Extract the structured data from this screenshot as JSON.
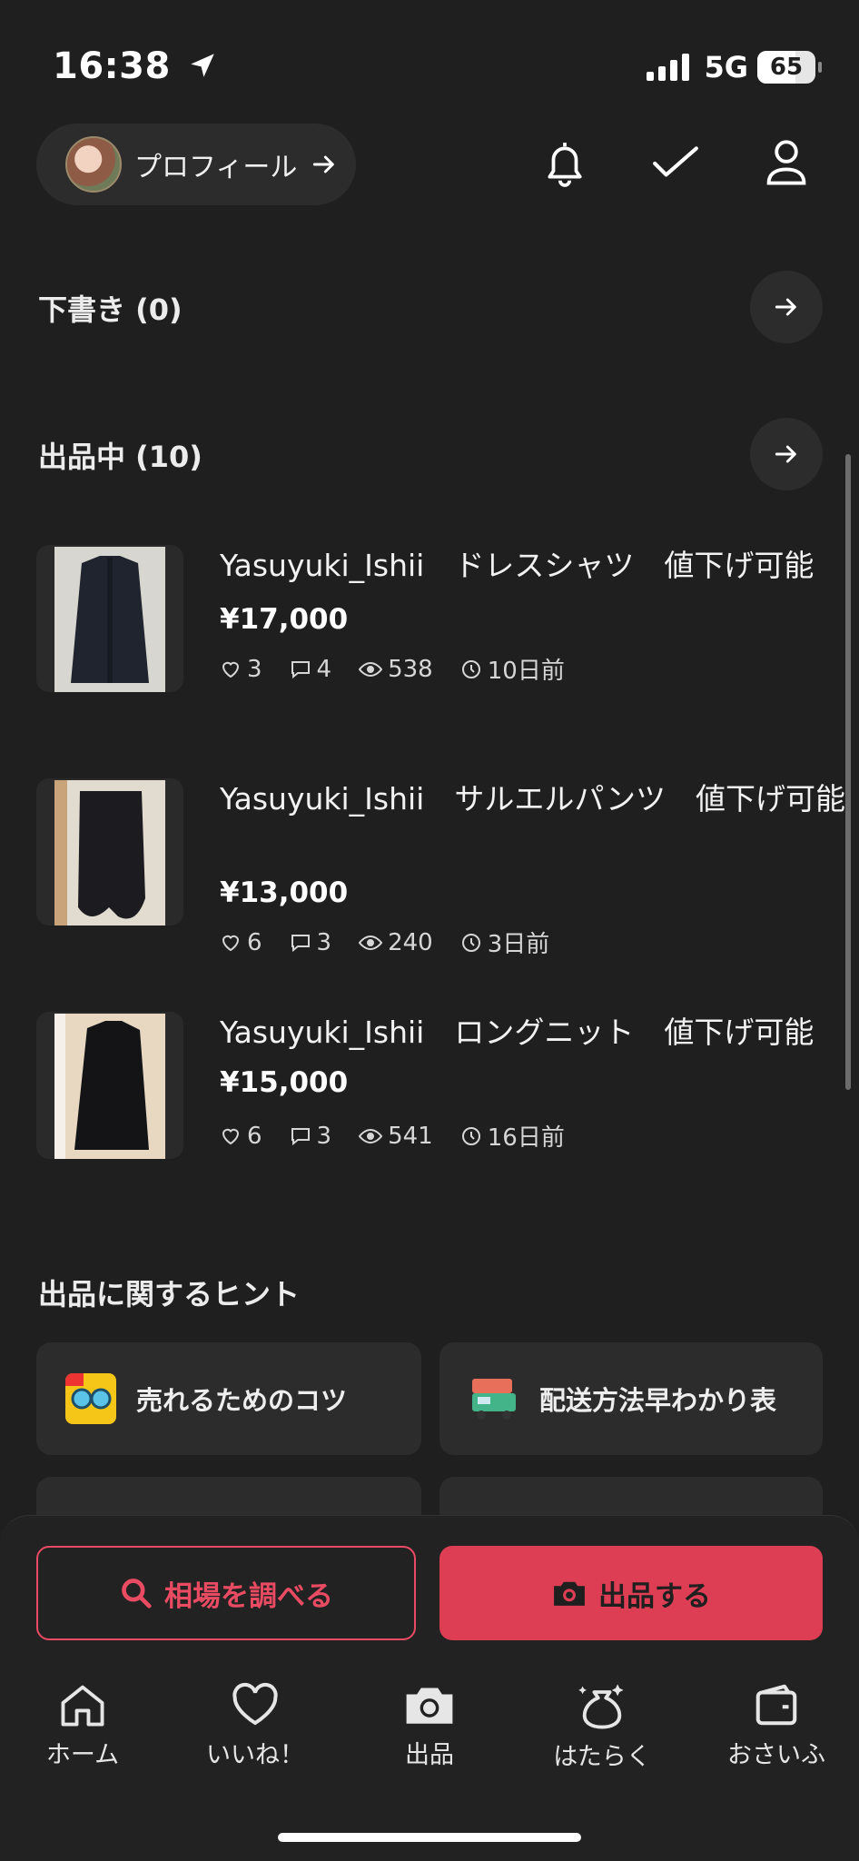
{
  "status_bar": {
    "time": "16:38",
    "network": "5G",
    "battery": "65",
    "battery_level": 0.65
  },
  "header": {
    "profile_label": "プロフィール"
  },
  "drafts": {
    "title": "下書き (0)"
  },
  "listing_section": {
    "title": "出品中 (10)",
    "items": [
      {
        "title": "Yasuyuki_Ishii　ドレスシャツ　値下げ可能",
        "price": "¥17,000",
        "likes": "3",
        "comments": "4",
        "views": "538",
        "age": "10日前"
      },
      {
        "title": "Yasuyuki_Ishii　サルエルパンツ　値下げ可能",
        "price": "¥13,000",
        "likes": "6",
        "comments": "3",
        "views": "240",
        "age": "3日前"
      },
      {
        "title": "Yasuyuki_Ishii　ロングニット　値下げ可能",
        "price": "¥15,000",
        "likes": "6",
        "comments": "3",
        "views": "541",
        "age": "16日前"
      }
    ]
  },
  "hints": {
    "title": "出品に関するヒント",
    "cards": [
      {
        "label": "売れるためのコツ",
        "icon": "sunglasses-icon"
      },
      {
        "label": "配送方法早わかり表",
        "icon": "truck-icon"
      }
    ]
  },
  "actions": {
    "search_price": "相場を調べる",
    "list_item": "出品する"
  },
  "tabs": [
    {
      "label": "ホーム",
      "icon": "home-icon"
    },
    {
      "label": "いいね！",
      "icon": "heart-icon"
    },
    {
      "label": "出品",
      "icon": "camera-icon"
    },
    {
      "label": "はたらく",
      "icon": "work-bag-icon"
    },
    {
      "label": "おさいふ",
      "icon": "wallet-icon"
    }
  ],
  "colors": {
    "accent": "#de3e54",
    "background": "#1f1f1f",
    "card": "#2c2c2c"
  }
}
